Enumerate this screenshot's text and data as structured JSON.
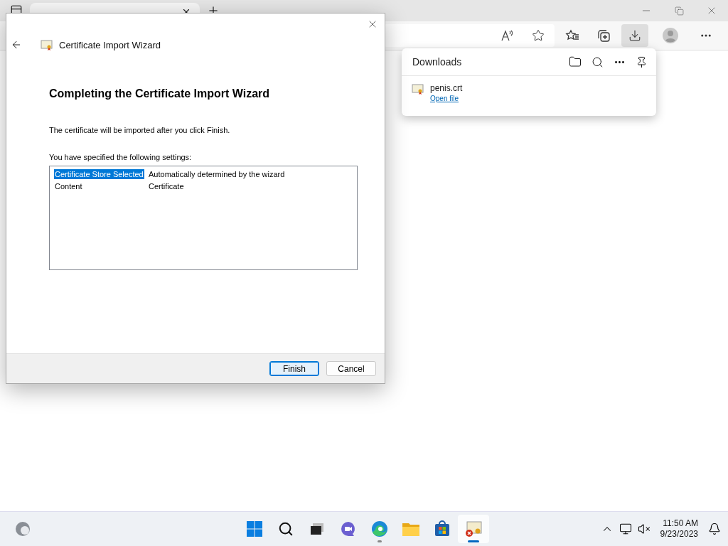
{
  "browser": {
    "tabs": [
      {
        "selected": true
      }
    ],
    "toolbar": [
      {
        "kind": "read-aloud",
        "selected": false
      },
      {
        "kind": "add-favorite",
        "selected": false
      },
      {
        "kind": "favorites",
        "selected": false
      },
      {
        "kind": "collections",
        "selected": false
      },
      {
        "kind": "downloads",
        "selected": true
      },
      {
        "kind": "profile",
        "selected": false
      },
      {
        "kind": "more",
        "selected": false
      }
    ]
  },
  "downloads_panel": {
    "title": "Downloads",
    "items": [
      {
        "file": "penis.crt",
        "action": "Open file"
      }
    ]
  },
  "dialog": {
    "title": "Certificate Import Wizard",
    "heading": "Completing the Certificate Import Wizard",
    "message": "The certificate will be imported after you click Finish.",
    "settings_label": "You have specified the following settings:",
    "settings": [
      {
        "name": "Certificate Store Selected",
        "value": "Automatically determined by the wizard",
        "selected": true
      },
      {
        "name": "Content",
        "value": "Certificate",
        "selected": false
      }
    ],
    "buttons": [
      {
        "label": "Finish",
        "kind": "default"
      },
      {
        "label": "Cancel",
        "kind": "normal"
      }
    ]
  },
  "taskbar": {
    "apps": [
      {
        "kind": "start",
        "running": false,
        "active": false
      },
      {
        "kind": "search",
        "running": false,
        "active": false
      },
      {
        "kind": "taskview",
        "running": false,
        "active": false
      },
      {
        "kind": "chat",
        "running": false,
        "active": false
      },
      {
        "kind": "edge",
        "running": true,
        "active": false
      },
      {
        "kind": "explorer",
        "running": false,
        "active": false
      },
      {
        "kind": "store",
        "running": false,
        "active": false
      },
      {
        "kind": "certificate",
        "running": true,
        "active": true
      }
    ],
    "time": "11:50 AM",
    "date": "9/23/2023"
  }
}
